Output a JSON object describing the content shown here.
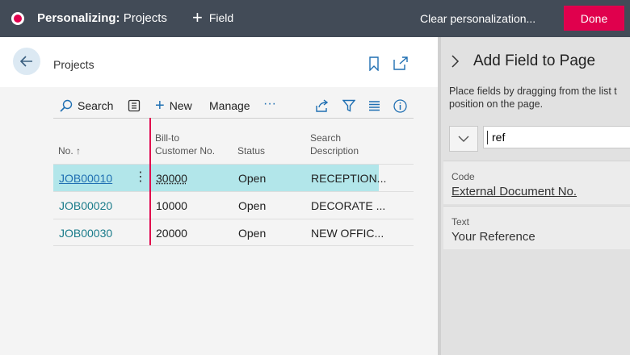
{
  "topbar": {
    "title_bold": "Personalizing:",
    "title_rest": "Projects",
    "field_label": "Field",
    "clear_label": "Clear personalization...",
    "done_label": "Done"
  },
  "page": {
    "title": "Projects",
    "actions": {
      "search": "Search",
      "new": "New",
      "manage": "Manage",
      "more": "···"
    },
    "columns": {
      "no": "No. ↑",
      "bill_to_1": "Bill-to",
      "bill_to_2": "Customer No.",
      "status": "Status",
      "desc_1": "Search",
      "desc_2": "Description"
    },
    "rows": [
      {
        "no": "JOB00010",
        "bill_to": "30000",
        "status": "Open",
        "desc": "RECEPTION..."
      },
      {
        "no": "JOB00020",
        "bill_to": "10000",
        "status": "Open",
        "desc": "DECORATE ..."
      },
      {
        "no": "JOB00030",
        "bill_to": "20000",
        "status": "Open",
        "desc": "NEW OFFIC..."
      }
    ],
    "row_menu": "⋮"
  },
  "panel": {
    "title": "Add Field to Page",
    "desc_line1": "Place fields by dragging from the list t",
    "desc_line2": "position on the page.",
    "search_value": "ref",
    "fields": [
      {
        "type": "Code",
        "name": "External Document No."
      },
      {
        "type": "Text",
        "name": "Your Reference"
      }
    ]
  },
  "colors": {
    "topbar": "#424b57",
    "accent": "#e0004d",
    "selected_row": "#b2e6ea",
    "link": "#1a7b8a"
  },
  "icons": [
    "record-icon",
    "plus-icon",
    "back-arrow-icon",
    "bookmark-icon",
    "popout-icon",
    "search-icon",
    "edit-list-icon",
    "share-icon",
    "filter-icon",
    "list-view-icon",
    "info-icon",
    "chevron-right-icon",
    "chevron-down-icon"
  ]
}
